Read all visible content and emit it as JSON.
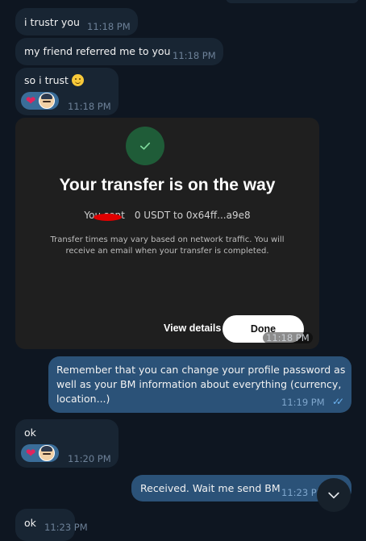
{
  "messages": [
    {
      "text": "i trustr you",
      "time": "11:18 PM"
    },
    {
      "text": "my friend referred me to you",
      "time": "11:18 PM"
    },
    {
      "text": "so i trust",
      "time": "11:18 PM"
    },
    {
      "card": {
        "title": "Your transfer is on the way",
        "sent_prefix": "You sent",
        "sent_suffix": "0 USDT to 0x64ff...a9e8",
        "note": "Transfer times may vary based on network traffic. You will\nreceive an email when your transfer is completed.",
        "view_details": "View details",
        "done": "Done"
      },
      "time": "11:18 PM"
    },
    {
      "text": "Remember that you can change your profile password as\nwell as your BM information about everything (currency,\nlocation...)",
      "time": "11:19 PM"
    },
    {
      "text": "ok",
      "time": "11:20 PM"
    },
    {
      "text": "Received. Wait me send BM",
      "time": "11:23 PM"
    },
    {
      "text": "ok",
      "time": "11:23 PM"
    }
  ],
  "colors": {
    "incoming": "#182533",
    "outgoing": "#2b5278",
    "background": "#0e1621",
    "checks": "#6cb3f0"
  },
  "icons": [
    "heart-icon",
    "avatar",
    "smile-emoji",
    "double-check-icon",
    "check-icon",
    "chevron-down-icon"
  ]
}
